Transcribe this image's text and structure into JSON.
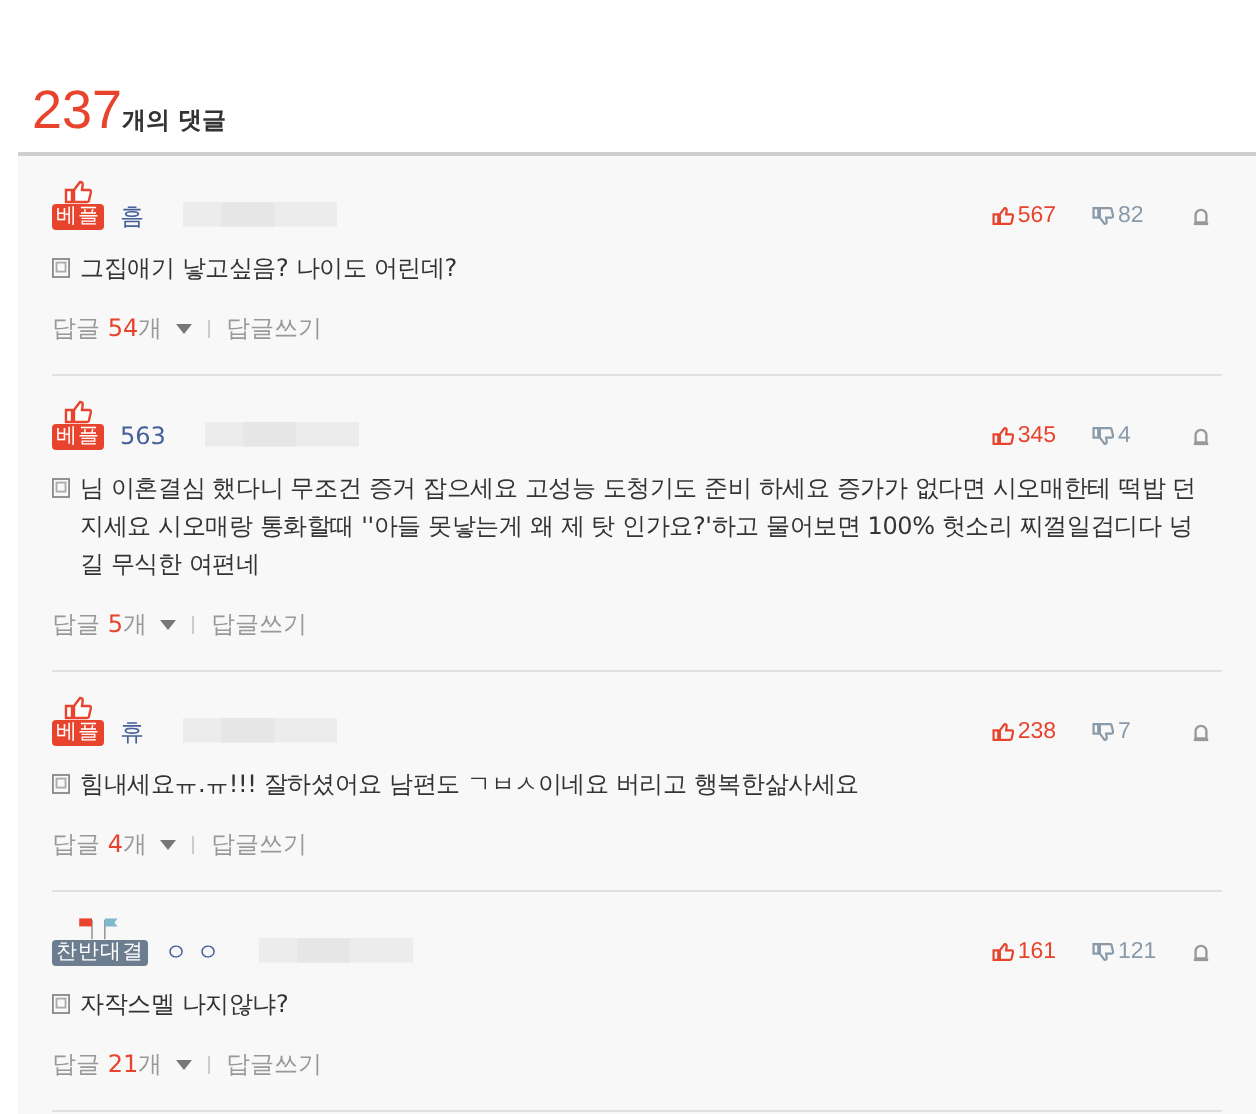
{
  "header": {
    "count": "237",
    "label": "개의 댓글"
  },
  "comments": [
    {
      "badge": {
        "kind": "best",
        "label": "베플"
      },
      "author": "흠",
      "likes": "567",
      "dislikes": "82",
      "text": "그집애기 낳고싶음? 나이도 어린데?",
      "reply_label": "답글",
      "reply_count": "54",
      "reply_unit": "개",
      "write_reply": "답글쓰기"
    },
    {
      "badge": {
        "kind": "best",
        "label": "베플"
      },
      "author": "563",
      "likes": "345",
      "dislikes": "4",
      "text": "님 이혼결심 했다니 무조건 증거 잡으세요 고성능 도청기도 준비 하세요 증가가 없다면 시오매한테 떡밥 던지세요 시오매랑 통화할때 ''아들 못낳는게 왜 제 탓 인가요?'하고 물어보면 100% 헛소리 찌껄일겁디다 넝길 무식한 여편네",
      "reply_label": "답글",
      "reply_count": "5",
      "reply_unit": "개",
      "write_reply": "답글쓰기"
    },
    {
      "badge": {
        "kind": "best",
        "label": "베플"
      },
      "author": "휴",
      "likes": "238",
      "dislikes": "7",
      "text": "힘내세요ㅠ.ㅠ!!! 잘하셨어요 남편도 ㄱㅂㅅ이네요 버리고 행복한삶사세요",
      "reply_label": "답글",
      "reply_count": "4",
      "reply_unit": "개",
      "write_reply": "답글쓰기"
    },
    {
      "badge": {
        "kind": "debate",
        "label": "찬반대결"
      },
      "author": "ㅇ ㅇ",
      "likes": "161",
      "dislikes": "121",
      "text": "자작스멜 나지않냐?",
      "reply_label": "답글",
      "reply_count": "21",
      "reply_unit": "개",
      "write_reply": "답글쓰기"
    }
  ]
}
